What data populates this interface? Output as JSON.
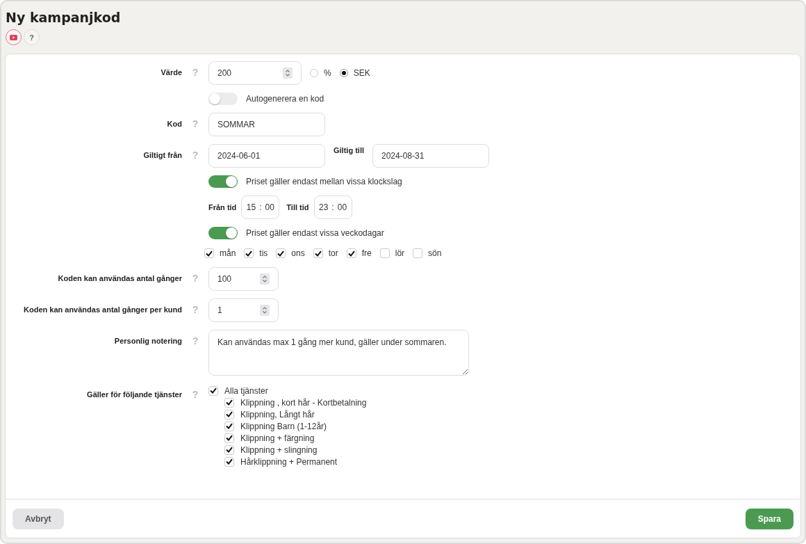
{
  "page": {
    "title": "Ny kampanjkod",
    "help": "?"
  },
  "form": {
    "value": {
      "label": "Värde",
      "help": "?",
      "value": "200",
      "units": [
        {
          "label": "%",
          "selected": false
        },
        {
          "label": "SEK",
          "selected": true
        }
      ]
    },
    "autogenerate": {
      "label": "Autogenerera en kod",
      "on": false
    },
    "code": {
      "label": "Kod",
      "help": "?",
      "value": "SOMMAR"
    },
    "valid_from": {
      "label": "Giltigt från",
      "help": "?",
      "value": "2024-06-01"
    },
    "valid_to": {
      "label": "Giltig till",
      "value": "2024-08-31"
    },
    "time_restriction": {
      "label": "Priset gäller endast mellan vissa klockslag",
      "on": true
    },
    "from_time": {
      "label": "Från tid",
      "hours": "15",
      "separator": ":",
      "minutes": "00"
    },
    "to_time": {
      "label": "Till tid",
      "hours": "23",
      "separator": ":",
      "minutes": "00"
    },
    "weekday_restriction": {
      "label": "Priset gäller endast vissa veckodagar",
      "on": true
    },
    "weekdays": [
      {
        "label": "mån",
        "checked": true
      },
      {
        "label": "tis",
        "checked": true
      },
      {
        "label": "ons",
        "checked": true
      },
      {
        "label": "tor",
        "checked": true
      },
      {
        "label": "fre",
        "checked": true
      },
      {
        "label": "lör",
        "checked": false
      },
      {
        "label": "sön",
        "checked": false
      }
    ],
    "max_uses": {
      "label": "Koden kan användas antal gånger",
      "help": "?",
      "value": "100"
    },
    "max_uses_per_customer": {
      "label": "Koden kan användas antal gånger per kund",
      "help": "?",
      "value": "1"
    },
    "note": {
      "label": "Personlig notering",
      "help": "?",
      "value": "Kan användas max 1 gång mer kund, gäller under sommaren."
    },
    "services": {
      "label": "Gäller för följande tjänster",
      "help": "?",
      "items": [
        {
          "label": "Alla tjänster",
          "checked": true,
          "children": [
            {
              "label": "Klippning , kort hår - Kortbetalning",
              "checked": true
            },
            {
              "label": "Klippning, Långt hår",
              "checked": true
            },
            {
              "label": "Klippning Barn (1-12år)",
              "checked": true
            },
            {
              "label": "Klippning + färgning",
              "checked": true
            },
            {
              "label": "Klippning + slingning",
              "checked": true
            },
            {
              "label": "Hårklippning + Permanent",
              "checked": true
            }
          ]
        }
      ]
    }
  },
  "footer": {
    "cancel": "Avbryt",
    "save": "Spara"
  }
}
